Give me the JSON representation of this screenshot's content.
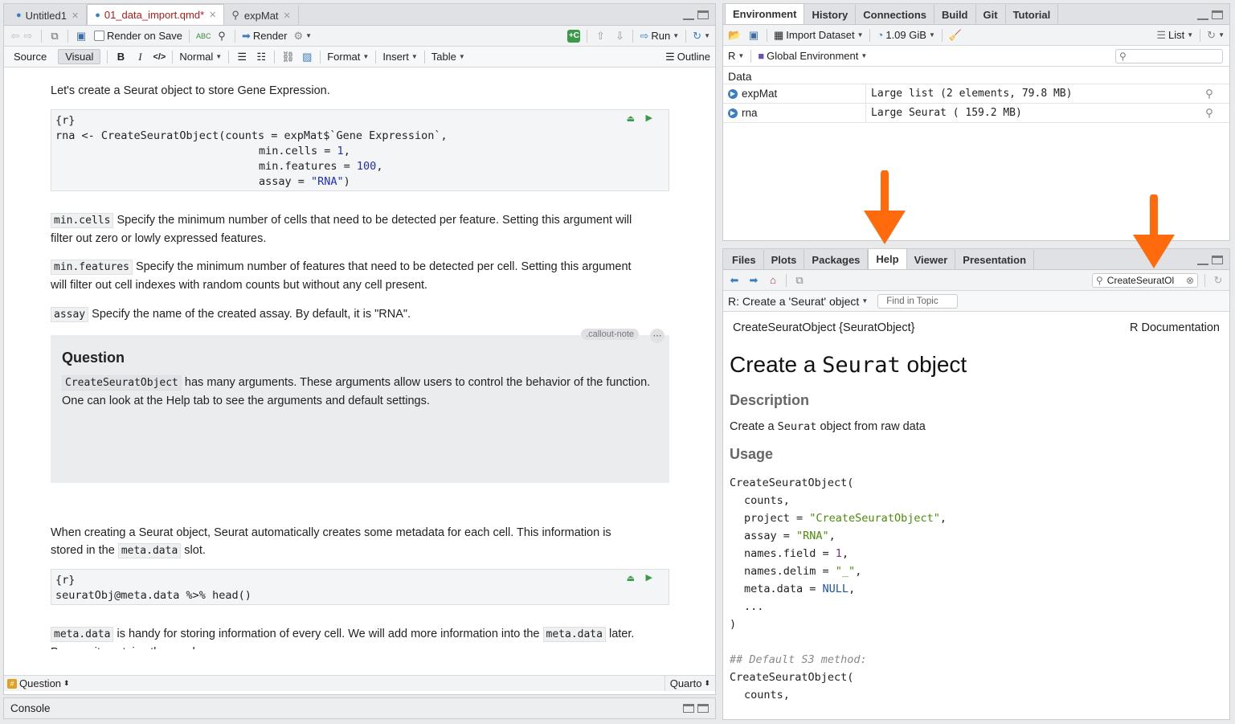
{
  "source_pane": {
    "tabs": [
      {
        "label": "Untitled1"
      },
      {
        "label": "01_data_import.qmd*"
      },
      {
        "label": "expMat"
      }
    ],
    "toolbar1": {
      "render_on_save": "Render on Save",
      "render": "Render",
      "run": "Run"
    },
    "toolbar2": {
      "source": "Source",
      "visual": "Visual",
      "normal": "Normal",
      "format": "Format",
      "insert": "Insert",
      "table": "Table",
      "outline": "Outline"
    },
    "content": {
      "p1": "Let's create a Seurat object to store Gene Expression.",
      "chunk1_header": "{r}",
      "chunk1_l1a": "rna <- CreateSeuratObject(counts = expMat$`Gene Expression`,",
      "chunk1_l2a": "min.cells = ",
      "chunk1_l2b": "1",
      "chunk1_l2c": ",",
      "chunk1_l3a": "min.features = ",
      "chunk1_l3b": "100",
      "chunk1_l3c": ",",
      "chunk1_l4a": "assay = ",
      "chunk1_l4b": "\"RNA\"",
      "chunk1_l4c": ")",
      "mincells_code": "min.cells",
      "mincells_text": " Specify the minimum number of cells that need to be detected per feature. Setting this argument will filter out zero or lowly expressed features.",
      "minfeatures_code": "min.features",
      "minfeatures_text": " Specify the minimum number of features that need to be detected per cell. Setting this argument will filter out cell indexes with random counts but without any cell present.",
      "assay_code": "assay",
      "assay_text": " Specify the name of the created assay. By default, it is \"RNA\".",
      "callout_tag": ".callout-note",
      "callout_more": "⋯",
      "question_title": "Question",
      "question_code": "CreateSeuratObject",
      "question_text": " has many arguments. These arguments allow users to control the behavior of the function. One can look at the Help tab to see the arguments and default settings.",
      "p_meta_a": "When creating a Seurat object, Seurat automatically creates some metadata for each cell. This information is stored in the ",
      "p_meta_code": "meta.data",
      "p_meta_b": " slot.",
      "chunk2_header": "{r}",
      "chunk2_line": "seuratObj@meta.data %>% head()",
      "p_last_code1": "meta.data",
      "p_last_a": " is handy for storing information of every cell. We will add more information into the ",
      "p_last_code2": "meta.data",
      "p_last_b": " later. By now, it contains three columns:"
    },
    "status_left": "Question",
    "status_right": "Quarto"
  },
  "console": {
    "label": "Console"
  },
  "env_pane": {
    "tabs": [
      "Environment",
      "History",
      "Connections",
      "Build",
      "Git",
      "Tutorial"
    ],
    "import_dataset": "Import Dataset",
    "memory": "1.09 GiB",
    "list": "List",
    "lang": "R",
    "global_env": "Global Environment",
    "section": "Data",
    "rows": [
      {
        "name": "expMat",
        "value": "Large list (2 elements,  79.8 MB)"
      },
      {
        "name": "rna",
        "value": "Large Seurat ( 159.2 MB)"
      }
    ]
  },
  "help_pane": {
    "tabs": [
      "Files",
      "Plots",
      "Packages",
      "Help",
      "Viewer",
      "Presentation"
    ],
    "search_value": "CreateSeuratOl",
    "topic_select": "R: Create a 'Seurat' object",
    "find_placeholder": "Find in Topic",
    "doc_left": "CreateSeuratObject {SeuratObject}",
    "doc_right": "R Documentation",
    "title_a": "Create a ",
    "title_code": "Seurat",
    "title_b": " object",
    "h_description": "Description",
    "desc_a": "Create a ",
    "desc_code": "Seurat",
    "desc_b": " object from raw data",
    "h_usage": "Usage",
    "usage": {
      "fn": "CreateSeuratObject(",
      "counts": "counts,",
      "project_a": "project = ",
      "project_b": "\"CreateSeuratObject\"",
      "assay_a": "assay = ",
      "assay_b": "\"RNA\"",
      "nf_a": "names.field = ",
      "nf_b": "1",
      "nd_a": "names.delim = ",
      "nd_b": "\"_\"",
      "md_a": "meta.data = ",
      "md_b": "NULL",
      "dots": "...",
      "close": ")",
      "comment": "## Default S3 method:",
      "fn2": "CreateSeuratObject(",
      "counts2": "counts,"
    }
  },
  "colors": {
    "arrow": "#ff6a0d",
    "accent": "#3a7dc7"
  }
}
